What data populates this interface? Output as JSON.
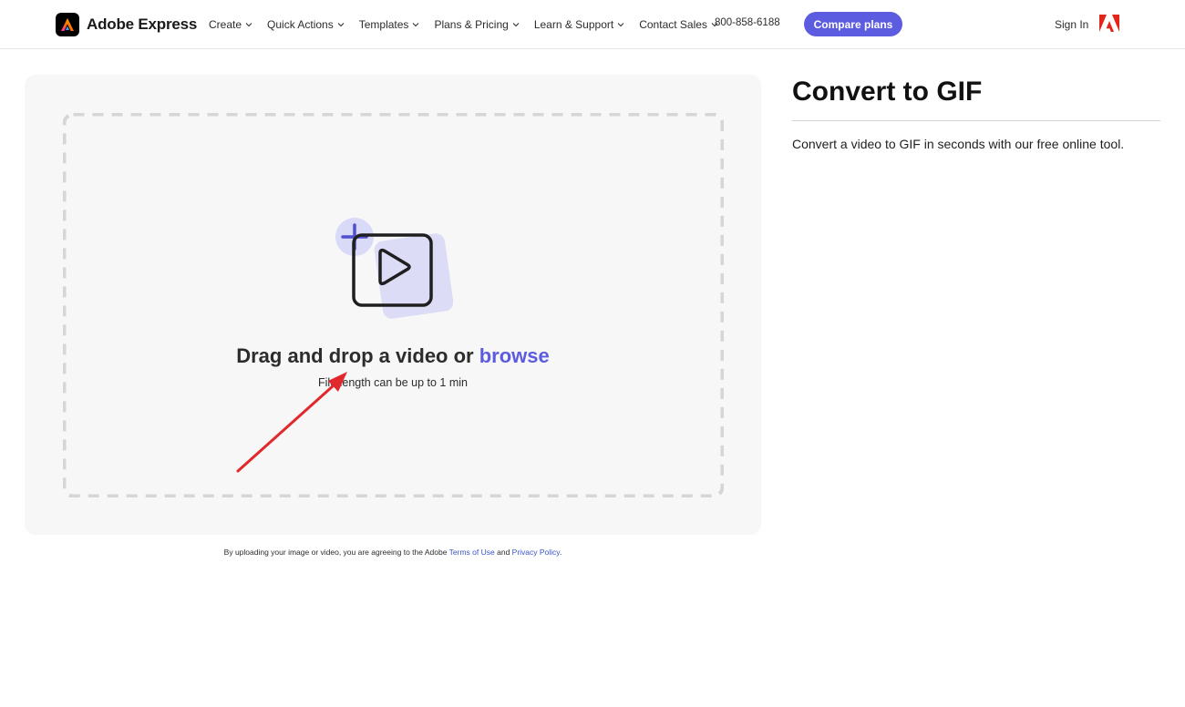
{
  "header": {
    "brand": "Adobe Express",
    "nav": [
      {
        "label": "Create"
      },
      {
        "label": "Quick Actions"
      },
      {
        "label": "Templates"
      },
      {
        "label": "Plans & Pricing"
      },
      {
        "label": "Learn & Support"
      },
      {
        "label": "Contact Sales"
      }
    ],
    "phone": "800-858-6188",
    "compare_label": "Compare plans",
    "signin_label": "Sign In"
  },
  "upload": {
    "drop_text": "Drag and drop a video or ",
    "browse_label": "browse",
    "length_note": "File length can be up to 1 min"
  },
  "legal": {
    "prefix": "By uploading your image or video, you are agreeing to the Adobe ",
    "terms_label": "Terms of Use",
    "middle": " and ",
    "privacy_label": "Privacy Policy",
    "suffix": "."
  },
  "sidebar": {
    "title": "Convert to GIF",
    "description": "Convert a video to GIF in seconds with our free online tool."
  },
  "colors": {
    "accent": "#5c5ce0",
    "annotation_arrow": "#e0282d",
    "panel_bg": "#f7f7f7"
  }
}
